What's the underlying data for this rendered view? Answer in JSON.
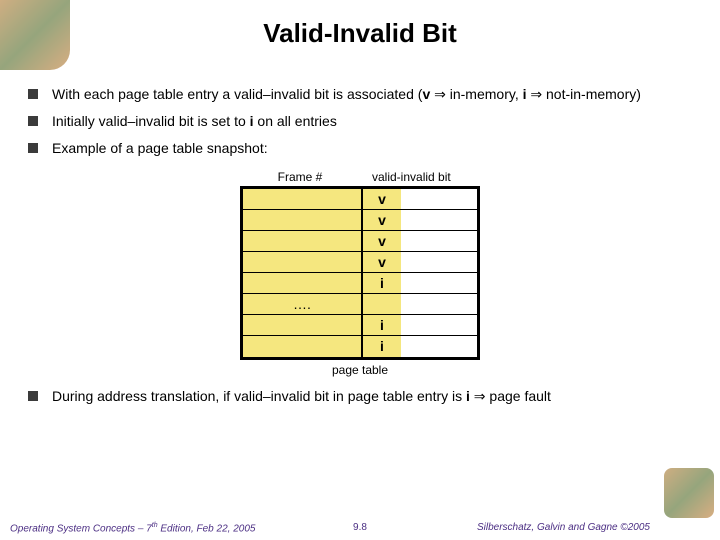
{
  "title": "Valid-Invalid Bit",
  "bullets": {
    "b1a": "With each page table entry a valid–invalid bit is associated (",
    "b1_v": "v",
    "b1_arr1": " ⇒ ",
    "b1_mem": "in-memory, ",
    "b1_i": "i",
    "b1_arr2": " ⇒ ",
    "b1_not": "not-in-memory)",
    "b2a": "Initially valid–invalid bit is set to ",
    "b2_i": "i",
    "b2b": " on all entries",
    "b3": "Example of a page table snapshot:",
    "b4a": "During address translation, if valid–invalid bit in page table entry is ",
    "b4_i": "i",
    "b4_arr": " ⇒ ",
    "b4b": "page fault"
  },
  "diagram": {
    "hdr_frame": "Frame #",
    "hdr_valid": "valid-invalid bit",
    "rows": [
      "v",
      "v",
      "v",
      "v",
      "i"
    ],
    "ellipsis": "….",
    "rows2": [
      "i",
      "i"
    ],
    "caption": "page table"
  },
  "footer": {
    "left": "Operating System Concepts – 7",
    "left_sup": "th",
    "left2": " Edition, Feb 22, 2005",
    "center": "9.8",
    "right": "Silberschatz, Galvin and Gagne ©2005"
  }
}
